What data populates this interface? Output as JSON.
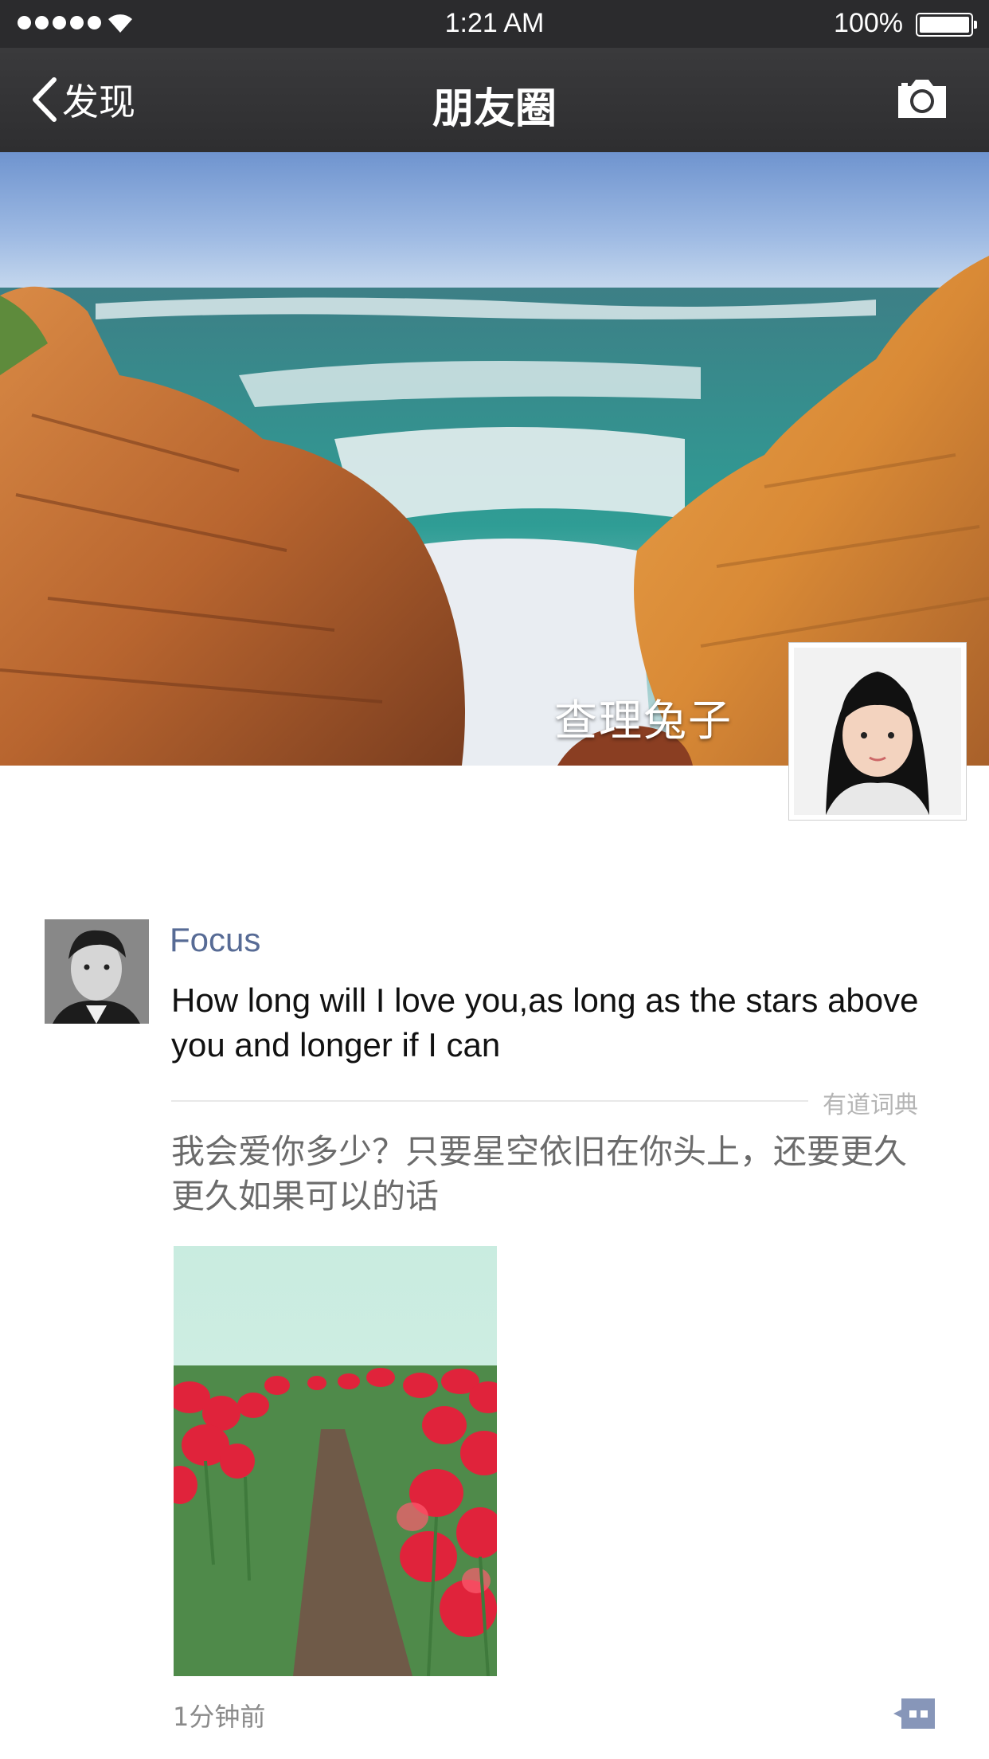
{
  "status_bar": {
    "time": "1:21 AM",
    "battery": "100%",
    "signal_icon": "signal-dots-icon",
    "wifi_icon": "wifi-icon",
    "battery_icon": "battery-icon"
  },
  "nav": {
    "back_label": "发现",
    "back_icon": "chevron-left-icon",
    "title": "朋友圈",
    "camera_icon": "camera-icon"
  },
  "cover": {
    "user_name": "查理兔子"
  },
  "post": {
    "author": "Focus",
    "text": "How long will I love you,as long as the stars above you and longer if I can",
    "translation_source": "有道词典",
    "translation": "我会爱你多少？只要星空依旧在你头上，还要更久更久如果可以的话",
    "time": "1分钟前",
    "comment_icon": "comment-icon"
  },
  "colors": {
    "nav_background": "#2e2e30",
    "author_name": "#576b95",
    "translation_text": "#6b6b6b",
    "secondary_text": "#8a8a8a"
  }
}
